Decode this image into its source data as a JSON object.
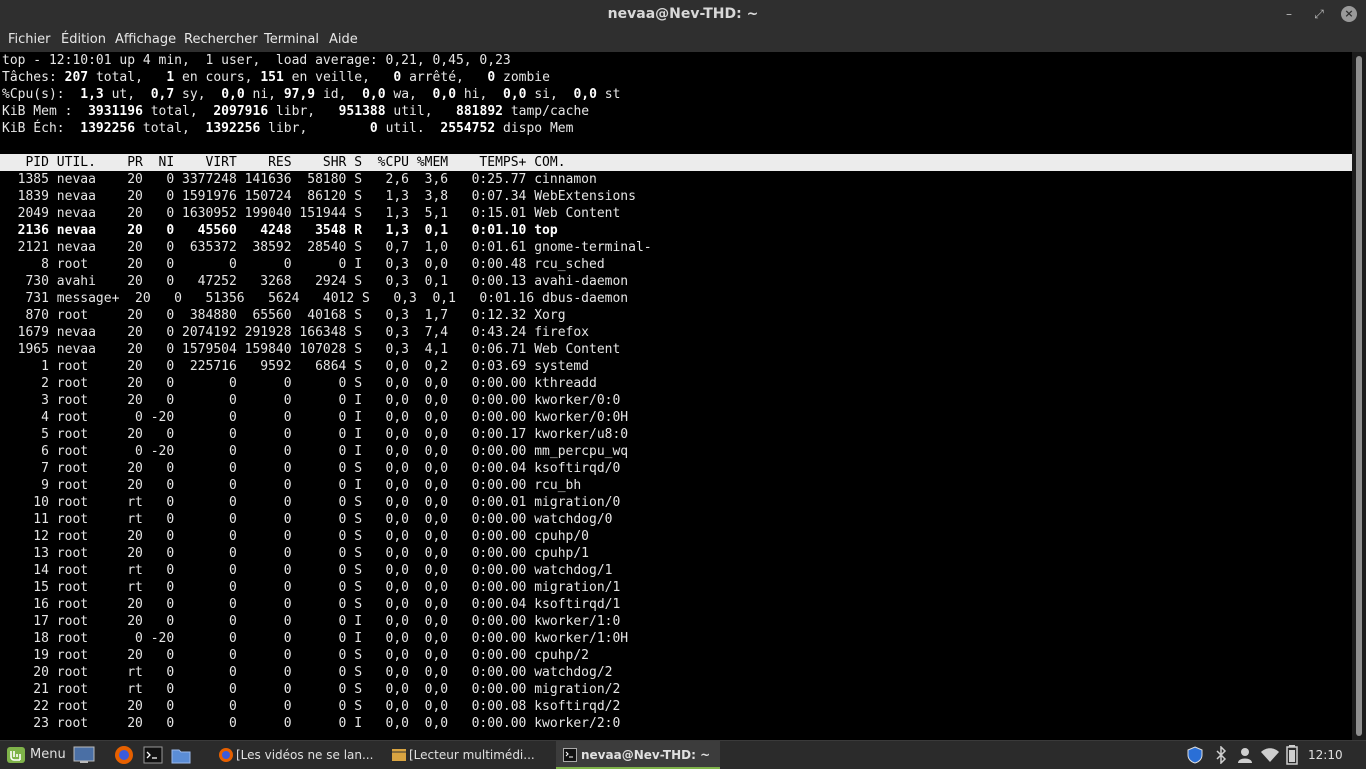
{
  "window": {
    "title": "nevaa@Nev-THD: ~",
    "minimize": "–",
    "maximize": "⤢",
    "close": "×"
  },
  "menu": [
    "Fichier",
    "Édition",
    "Affichage",
    "Rechercher",
    "Terminal",
    "Aide"
  ],
  "summary": {
    "line1": "top - 12:10:01 up 4 min,  1 user,  load average: 0,21, 0,45, 0,23",
    "tasks": {
      "label": "Tâches:",
      "total": "207",
      "total_lbl": "total,",
      "running": "1",
      "running_lbl": "en cours,",
      "sleeping": "151",
      "sleeping_lbl": "en veille,",
      "stopped": "0",
      "stopped_lbl": "arrêté,",
      "zombie": "0",
      "zombie_lbl": "zombie"
    },
    "cpu": {
      "label": "%Cpu(s):",
      "us": "1,3",
      "us_lbl": "ut,",
      "sy": "0,7",
      "sy_lbl": "sy,",
      "ni": "0,0",
      "ni_lbl": "ni,",
      "id": "97,9",
      "id_lbl": "id,",
      "wa": "0,0",
      "wa_lbl": "wa,",
      "hi": "0,0",
      "hi_lbl": "hi,",
      "si": "0,0",
      "si_lbl": "si,",
      "st": "0,0",
      "st_lbl": "st"
    },
    "mem": {
      "label": "KiB Mem :",
      "total": "3931196",
      "total_lbl": "total,",
      "free": "2097916",
      "free_lbl": "libr,",
      "used": "951388",
      "used_lbl": "util,",
      "cache": "881892",
      "cache_lbl": "tamp/cache"
    },
    "swap": {
      "label": "KiB Éch:",
      "total": "1392256",
      "total_lbl": "total,",
      "free": "1392256",
      "free_lbl": "libr,",
      "used": "0",
      "used_lbl": "util.",
      "avail": "2554752",
      "avail_lbl": "dispo Mem"
    }
  },
  "table": {
    "columns": [
      "PID",
      "UTIL.",
      "PR",
      "NI",
      "VIRT",
      "RES",
      "SHR",
      "S",
      "%CPU",
      "%MEM",
      "TEMPS+",
      "COM."
    ],
    "rows": [
      [
        "1385",
        "nevaa",
        "20",
        "0",
        "3377248",
        "141636",
        "58180",
        "S",
        "2,6",
        "3,6",
        "0:25.77",
        "cinnamon"
      ],
      [
        "1839",
        "nevaa",
        "20",
        "0",
        "1591976",
        "150724",
        "86120",
        "S",
        "1,3",
        "3,8",
        "0:07.34",
        "WebExtensions"
      ],
      [
        "2049",
        "nevaa",
        "20",
        "0",
        "1630952",
        "199040",
        "151944",
        "S",
        "1,3",
        "5,1",
        "0:15.01",
        "Web Content"
      ],
      [
        "2136",
        "nevaa",
        "20",
        "0",
        "45560",
        "4248",
        "3548",
        "R",
        "1,3",
        "0,1",
        "0:01.10",
        "top"
      ],
      [
        "2121",
        "nevaa",
        "20",
        "0",
        "635372",
        "38592",
        "28540",
        "S",
        "0,7",
        "1,0",
        "0:01.61",
        "gnome-terminal-"
      ],
      [
        "8",
        "root",
        "20",
        "0",
        "0",
        "0",
        "0",
        "I",
        "0,3",
        "0,0",
        "0:00.48",
        "rcu_sched"
      ],
      [
        "730",
        "avahi",
        "20",
        "0",
        "47252",
        "3268",
        "2924",
        "S",
        "0,3",
        "0,1",
        "0:00.13",
        "avahi-daemon"
      ],
      [
        "731",
        "message+",
        "20",
        "0",
        "51356",
        "5624",
        "4012",
        "S",
        "0,3",
        "0,1",
        "0:01.16",
        "dbus-daemon"
      ],
      [
        "870",
        "root",
        "20",
        "0",
        "384880",
        "65560",
        "40168",
        "S",
        "0,3",
        "1,7",
        "0:12.32",
        "Xorg"
      ],
      [
        "1679",
        "nevaa",
        "20",
        "0",
        "2074192",
        "291928",
        "166348",
        "S",
        "0,3",
        "7,4",
        "0:43.24",
        "firefox"
      ],
      [
        "1965",
        "nevaa",
        "20",
        "0",
        "1579504",
        "159840",
        "107028",
        "S",
        "0,3",
        "4,1",
        "0:06.71",
        "Web Content"
      ],
      [
        "1",
        "root",
        "20",
        "0",
        "225716",
        "9592",
        "6864",
        "S",
        "0,0",
        "0,2",
        "0:03.69",
        "systemd"
      ],
      [
        "2",
        "root",
        "20",
        "0",
        "0",
        "0",
        "0",
        "S",
        "0,0",
        "0,0",
        "0:00.00",
        "kthreadd"
      ],
      [
        "3",
        "root",
        "20",
        "0",
        "0",
        "0",
        "0",
        "I",
        "0,0",
        "0,0",
        "0:00.00",
        "kworker/0:0"
      ],
      [
        "4",
        "root",
        "0",
        "-20",
        "0",
        "0",
        "0",
        "I",
        "0,0",
        "0,0",
        "0:00.00",
        "kworker/0:0H"
      ],
      [
        "5",
        "root",
        "20",
        "0",
        "0",
        "0",
        "0",
        "I",
        "0,0",
        "0,0",
        "0:00.17",
        "kworker/u8:0"
      ],
      [
        "6",
        "root",
        "0",
        "-20",
        "0",
        "0",
        "0",
        "I",
        "0,0",
        "0,0",
        "0:00.00",
        "mm_percpu_wq"
      ],
      [
        "7",
        "root",
        "20",
        "0",
        "0",
        "0",
        "0",
        "S",
        "0,0",
        "0,0",
        "0:00.04",
        "ksoftirqd/0"
      ],
      [
        "9",
        "root",
        "20",
        "0",
        "0",
        "0",
        "0",
        "I",
        "0,0",
        "0,0",
        "0:00.00",
        "rcu_bh"
      ],
      [
        "10",
        "root",
        "rt",
        "0",
        "0",
        "0",
        "0",
        "S",
        "0,0",
        "0,0",
        "0:00.01",
        "migration/0"
      ],
      [
        "11",
        "root",
        "rt",
        "0",
        "0",
        "0",
        "0",
        "S",
        "0,0",
        "0,0",
        "0:00.00",
        "watchdog/0"
      ],
      [
        "12",
        "root",
        "20",
        "0",
        "0",
        "0",
        "0",
        "S",
        "0,0",
        "0,0",
        "0:00.00",
        "cpuhp/0"
      ],
      [
        "13",
        "root",
        "20",
        "0",
        "0",
        "0",
        "0",
        "S",
        "0,0",
        "0,0",
        "0:00.00",
        "cpuhp/1"
      ],
      [
        "14",
        "root",
        "rt",
        "0",
        "0",
        "0",
        "0",
        "S",
        "0,0",
        "0,0",
        "0:00.00",
        "watchdog/1"
      ],
      [
        "15",
        "root",
        "rt",
        "0",
        "0",
        "0",
        "0",
        "S",
        "0,0",
        "0,0",
        "0:00.00",
        "migration/1"
      ],
      [
        "16",
        "root",
        "20",
        "0",
        "0",
        "0",
        "0",
        "S",
        "0,0",
        "0,0",
        "0:00.04",
        "ksoftirqd/1"
      ],
      [
        "17",
        "root",
        "20",
        "0",
        "0",
        "0",
        "0",
        "I",
        "0,0",
        "0,0",
        "0:00.00",
        "kworker/1:0"
      ],
      [
        "18",
        "root",
        "0",
        "-20",
        "0",
        "0",
        "0",
        "I",
        "0,0",
        "0,0",
        "0:00.00",
        "kworker/1:0H"
      ],
      [
        "19",
        "root",
        "20",
        "0",
        "0",
        "0",
        "0",
        "S",
        "0,0",
        "0,0",
        "0:00.00",
        "cpuhp/2"
      ],
      [
        "20",
        "root",
        "rt",
        "0",
        "0",
        "0",
        "0",
        "S",
        "0,0",
        "0,0",
        "0:00.00",
        "watchdog/2"
      ],
      [
        "21",
        "root",
        "rt",
        "0",
        "0",
        "0",
        "0",
        "S",
        "0,0",
        "0,0",
        "0:00.00",
        "migration/2"
      ],
      [
        "22",
        "root",
        "20",
        "0",
        "0",
        "0",
        "0",
        "S",
        "0,0",
        "0,0",
        "0:00.08",
        "ksoftirqd/2"
      ],
      [
        "23",
        "root",
        "20",
        "0",
        "0",
        "0",
        "0",
        "I",
        "0,0",
        "0,0",
        "0:00.00",
        "kworker/2:0"
      ]
    ],
    "bold_pid": "2136"
  },
  "taskbar": {
    "menu_label": "Menu",
    "tasks": [
      "[Les vidéos ne se lan...",
      "[Lecteur multimédi...",
      "nevaa@Nev-THD: ~"
    ],
    "clock": "12:10",
    "icons": [
      "mint-logo-icon",
      "show-desktop-icon",
      "firefox-icon",
      "terminal-icon",
      "files-icon",
      "shield-icon",
      "bluetooth-icon",
      "user-icon",
      "wifi-icon",
      "battery-icon"
    ]
  },
  "colors": {
    "titlebar": "#2f2f2f",
    "terminal_bg": "#000000",
    "header_bg": "#ececec",
    "accent": "#7fb34a"
  }
}
